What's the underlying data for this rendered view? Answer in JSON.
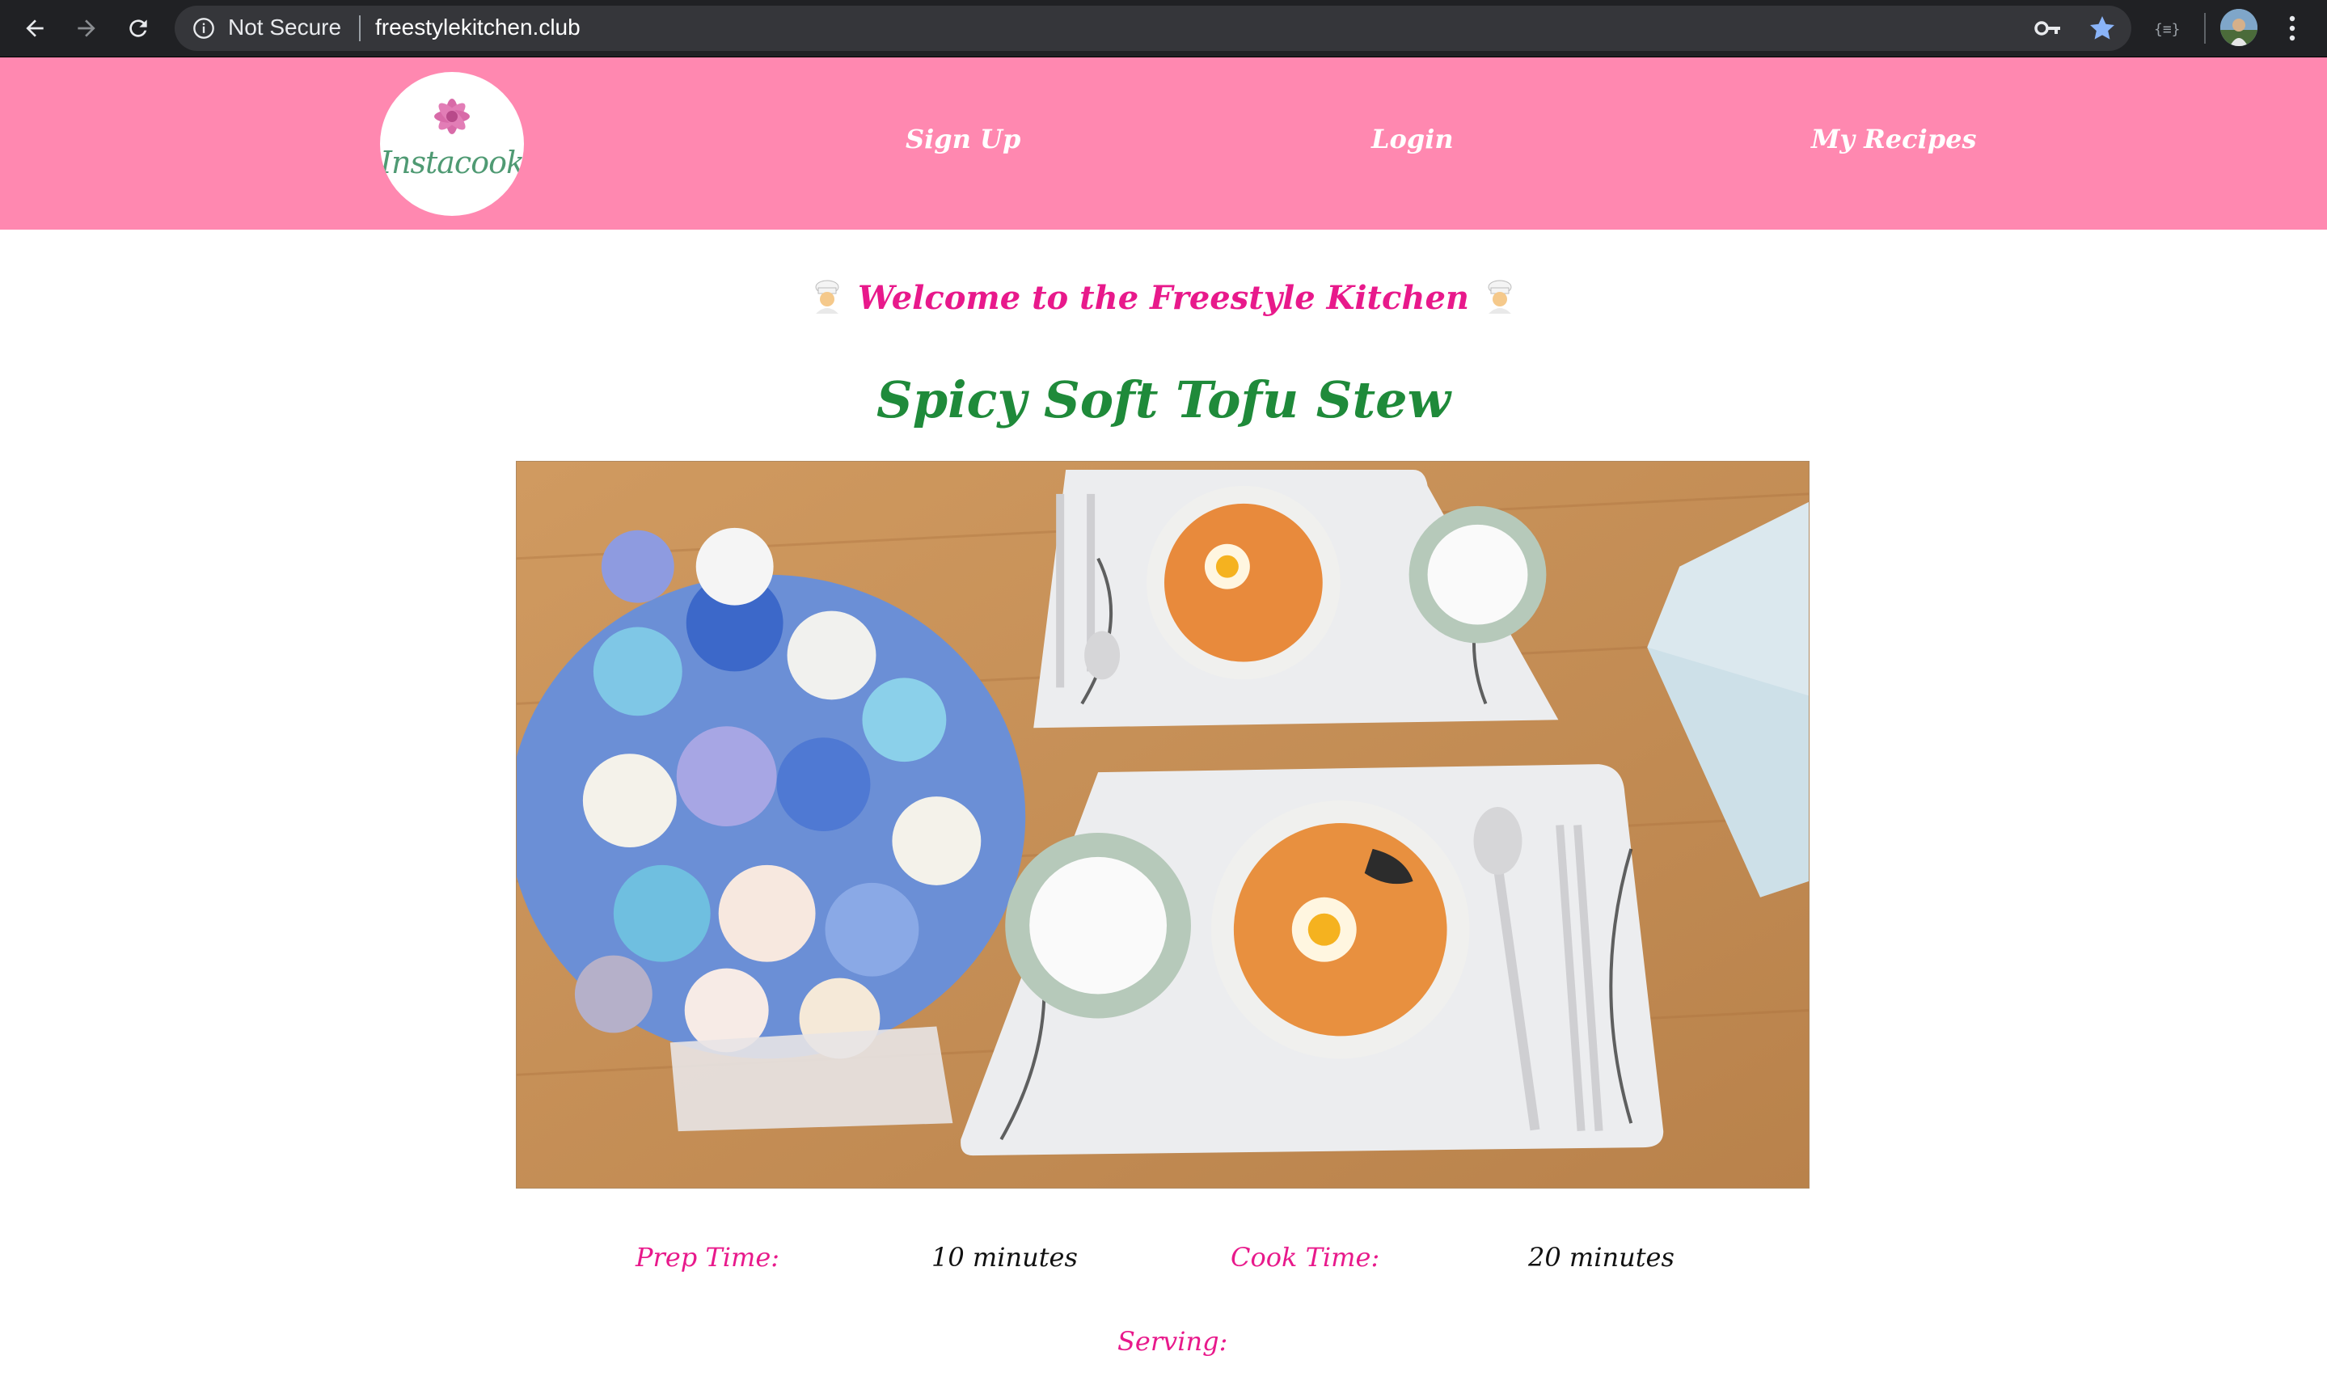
{
  "browser": {
    "security_label": "Not Secure",
    "url": "freestylekitchen.club"
  },
  "header": {
    "logo_text": "Instacook",
    "nav": {
      "signup": "Sign Up",
      "login": "Login",
      "my_recipes": "My Recipes"
    },
    "background_color": "#ff88b0"
  },
  "main": {
    "welcome": "Welcome to the Freestyle Kitchen",
    "recipe_title": "Spicy Soft Tofu Stew",
    "prep_label": "Prep Time:",
    "prep_value": "10 minutes",
    "cook_label": "Cook Time:",
    "cook_value": "20 minutes",
    "serving_label": "Serving:"
  },
  "colors": {
    "accent_pink": "#e8198b",
    "title_green": "#1f8a3a"
  }
}
